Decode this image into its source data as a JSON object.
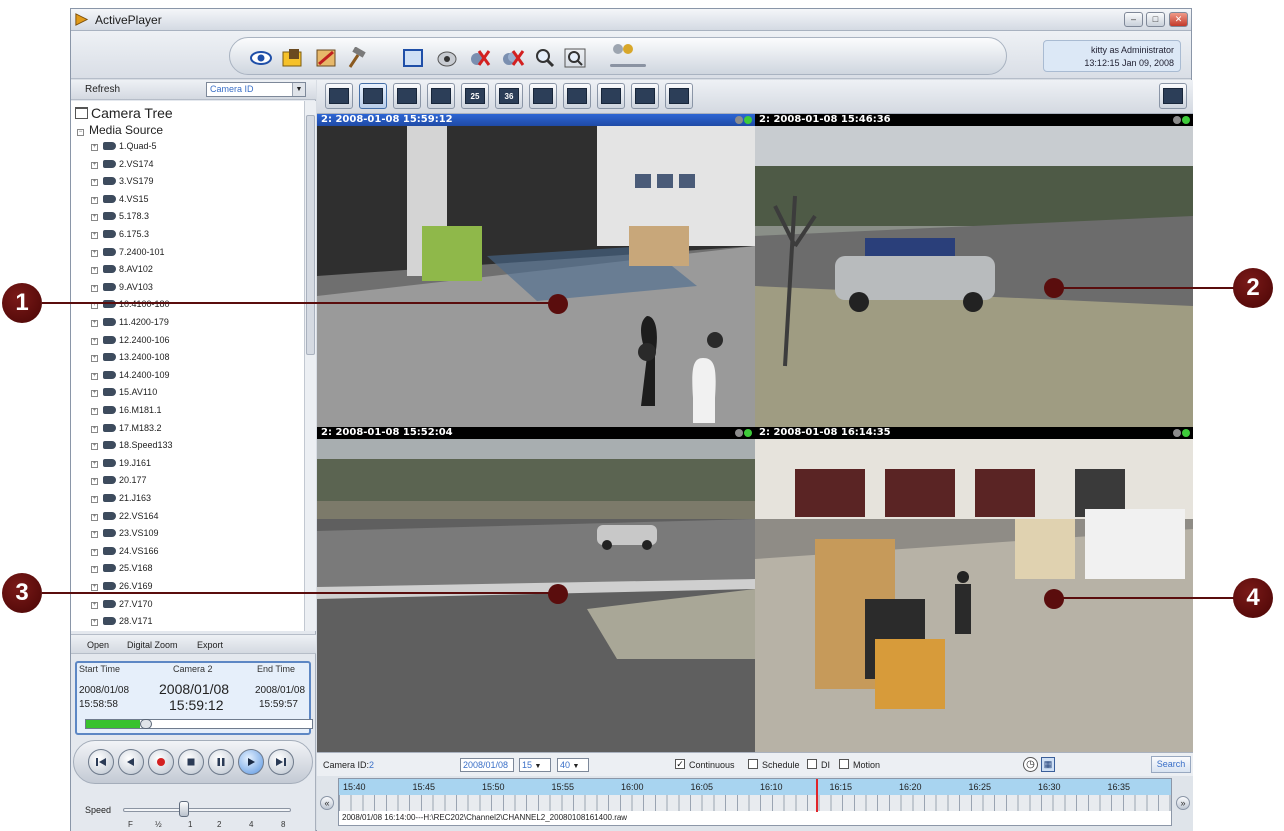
{
  "window": {
    "title": "ActivePlayer"
  },
  "user": {
    "line1": "kitty as Administrator",
    "line2": "13:12:15 Jan 09, 2008"
  },
  "toolbar": {
    "tools": [
      "eye-icon",
      "folder-icon",
      "camera-config-icon",
      "hammer-icon",
      "fullscreen-icon",
      "snapshot-icon",
      "disconnect-icon",
      "disconnect-all-icon",
      "zoom-in-icon",
      "zoom-fit-icon",
      "audio-icon"
    ]
  },
  "left": {
    "refresh": "Refresh",
    "camera_select": "Camera ID",
    "tree_root": "Camera Tree",
    "media_source": "Media Source",
    "cameras": [
      "1.Quad-5",
      "2.VS174",
      "3.VS179",
      "4.VS15",
      "5.178.3",
      "6.175.3",
      "7.2400-101",
      "8.AV102",
      "9.AV103",
      "10.4100-180",
      "11.4200-179",
      "12.2400-106",
      "13.2400-108",
      "14.2400-109",
      "15.AV110",
      "16.M181.1",
      "17.M183.2",
      "18.Speed133",
      "19.J161",
      "20.177",
      "21.J163",
      "22.VS164",
      "23.VS109",
      "24.VS166",
      "25.V168",
      "26.V169",
      "27.V170",
      "28.V171"
    ],
    "actions": {
      "open": "Open",
      "digital_zoom": "Digital Zoom",
      "export": "Export"
    }
  },
  "playback": {
    "start_time_label": "Start Time",
    "camera_label": "Camera 2",
    "end_time_label": "End Time",
    "start_date": "2008/01/08",
    "start_time": "15:58:58",
    "current_date": "2008/01/08",
    "current_time": "15:59:12",
    "end_date": "2008/01/08",
    "end_time": "15:59:57",
    "progress": 0.24
  },
  "speed": {
    "label": "Speed",
    "ticks": [
      "F",
      "½",
      "1",
      "2",
      "4",
      "8"
    ]
  },
  "views": [
    {
      "header": "2:  2008-01-08 15:59:12",
      "active": true
    },
    {
      "header": "2:  2008-01-08 15:46:36",
      "active": false
    },
    {
      "header": "2:  2008-01-08 15:52:04",
      "active": false
    },
    {
      "header": "2:  2008-01-08 16:14:35",
      "active": false
    }
  ],
  "layouts": [
    "",
    "",
    "",
    "",
    "25",
    "36",
    "",
    "",
    "",
    "",
    ""
  ],
  "search": {
    "camera_label": "Camera ID:",
    "camera_value": "2",
    "date": "2008/01/08",
    "hour": "15",
    "minute": "40",
    "continuous": "Continuous",
    "schedule": "Schedule",
    "di": "DI",
    "motion": "Motion",
    "button": "Search"
  },
  "timeline": {
    "times": [
      "15:40",
      "15:45",
      "15:50",
      "15:55",
      "16:00",
      "16:05",
      "16:10",
      "16:15",
      "16:20",
      "16:25",
      "16:30",
      "16:35"
    ],
    "file": "2008/01/08 16:14:00---H:\\REC202\\Channel2\\CHANNEL2_20080108161400.raw",
    "cursor_time": "16:14"
  },
  "callouts": [
    "1",
    "2",
    "3",
    "4"
  ],
  "colors": {
    "callout": "#5a0d0d",
    "active_header": "#2d66d4",
    "timeline_bar": "#a8d4f0",
    "progress": "#39c22e",
    "cursor": "#e0242a"
  }
}
